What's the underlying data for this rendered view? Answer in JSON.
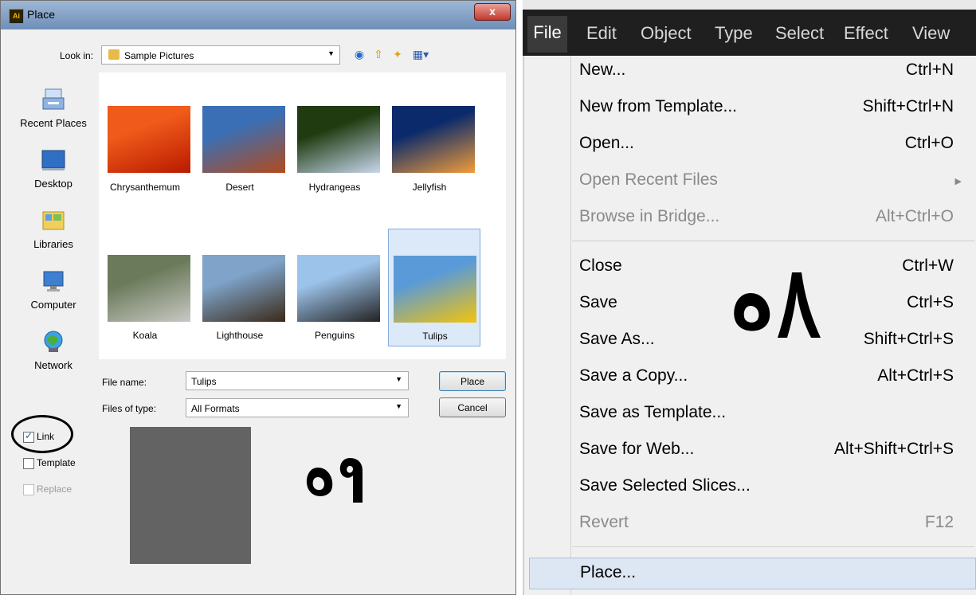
{
  "dialog": {
    "title": "Place",
    "app_icon": "Ai",
    "close_label": "x",
    "look_in_label": "Look in:",
    "look_in_value": "Sample Pictures",
    "places": [
      {
        "label": "Recent Places",
        "icon": "recent-places-icon"
      },
      {
        "label": "Desktop",
        "icon": "desktop-icon"
      },
      {
        "label": "Libraries",
        "icon": "libraries-icon"
      },
      {
        "label": "Computer",
        "icon": "computer-icon"
      },
      {
        "label": "Network",
        "icon": "network-icon"
      }
    ],
    "files": [
      {
        "name": "Chrysanthemum",
        "colors": [
          "#f05a1a",
          "#b81a00"
        ]
      },
      {
        "name": "Desert",
        "colors": [
          "#3a6fb5",
          "#b34a1c"
        ]
      },
      {
        "name": "Hydrangeas",
        "colors": [
          "#1f3b0f",
          "#c8d7ee"
        ]
      },
      {
        "name": "Jellyfish",
        "colors": [
          "#0a2a6b",
          "#f29c3a"
        ]
      },
      {
        "name": "Koala",
        "colors": [
          "#6a7a5a",
          "#c9c9c4"
        ]
      },
      {
        "name": "Lighthouse",
        "colors": [
          "#7fa3c9",
          "#3a2a18"
        ]
      },
      {
        "name": "Penguins",
        "colors": [
          "#9cc3ea",
          "#222222"
        ]
      },
      {
        "name": "Tulips",
        "colors": [
          "#5a9ad8",
          "#f2c40d"
        ]
      }
    ],
    "selected_file": "Tulips",
    "file_name_label": "File name:",
    "file_name_value": "Tulips",
    "files_of_type_label": "Files of type:",
    "files_of_type_value": "All Formats",
    "place_button": "Place",
    "cancel_button": "Cancel",
    "options": [
      {
        "label": "Link",
        "checked": true,
        "enabled": true
      },
      {
        "label": "Template",
        "checked": false,
        "enabled": true
      },
      {
        "label": "Replace",
        "checked": false,
        "enabled": false
      }
    ],
    "preview_color": "#636363",
    "annotation": "۵۹"
  },
  "menubar": {
    "items": [
      "File",
      "Edit",
      "Object",
      "Type",
      "Select",
      "Effect",
      "View"
    ],
    "active": "File"
  },
  "file_menu": {
    "items": [
      {
        "label": "New...",
        "shortcut": "Ctrl+N",
        "enabled": true
      },
      {
        "label": "New from Template...",
        "shortcut": "Shift+Ctrl+N",
        "enabled": true
      },
      {
        "label": "Open...",
        "shortcut": "Ctrl+O",
        "enabled": true
      },
      {
        "label": "Open Recent Files",
        "shortcut": "",
        "enabled": false,
        "submenu": true
      },
      {
        "label": "Browse in Bridge...",
        "shortcut": "Alt+Ctrl+O",
        "enabled": false
      },
      {
        "label": "Close",
        "shortcut": "Ctrl+W",
        "enabled": true
      },
      {
        "label": "Save",
        "shortcut": "Ctrl+S",
        "enabled": true
      },
      {
        "label": "Save As...",
        "shortcut": "Shift+Ctrl+S",
        "enabled": true
      },
      {
        "label": "Save a Copy...",
        "shortcut": "Alt+Ctrl+S",
        "enabled": true
      },
      {
        "label": "Save as Template...",
        "shortcut": "",
        "enabled": true
      },
      {
        "label": "Save for Web...",
        "shortcut": "Alt+Shift+Ctrl+S",
        "enabled": true
      },
      {
        "label": "Save Selected Slices...",
        "shortcut": "",
        "enabled": true
      },
      {
        "label": "Revert",
        "shortcut": "F12",
        "enabled": false
      },
      {
        "label": "Place...",
        "shortcut": "",
        "enabled": true,
        "highlighted": true
      }
    ],
    "annotation": "۵۸",
    "highlight_color": "#dde7f4"
  }
}
